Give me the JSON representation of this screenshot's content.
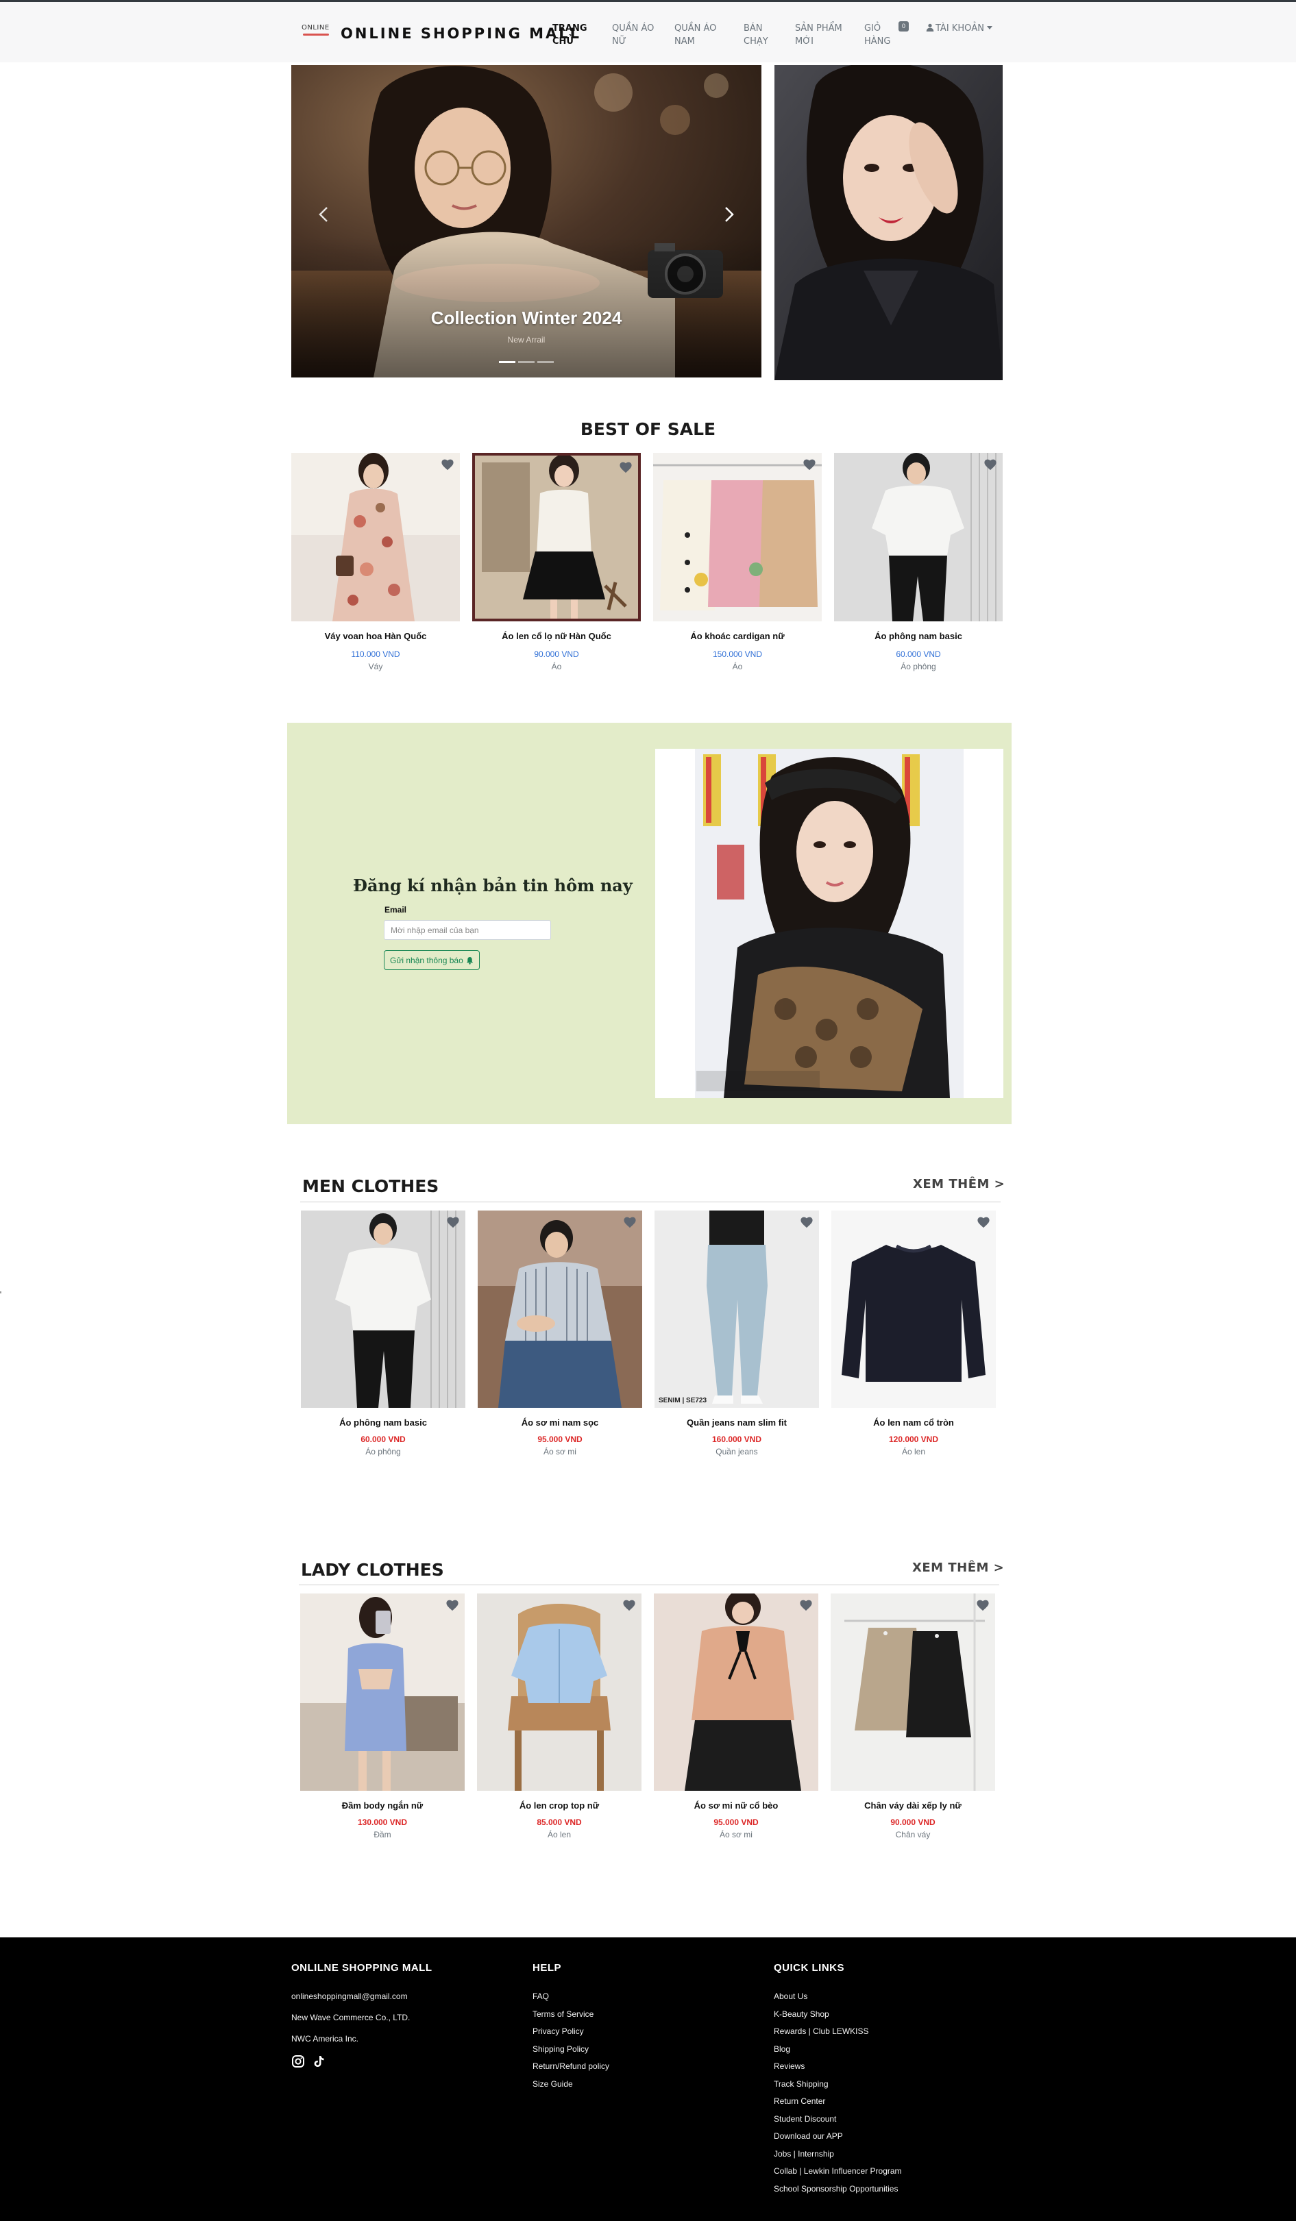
{
  "navbar": {
    "logo_text": "ONLINE",
    "brand": "ONLINE SHOPPING MALL",
    "links": [
      {
        "label": "TRANG CHỦ",
        "active": true
      },
      {
        "label": "QUẦN ÁO NỮ",
        "active": false
      },
      {
        "label": "QUẦN ÁO NAM",
        "active": false
      },
      {
        "label": "BÁN CHẠY",
        "active": false
      },
      {
        "label": "SẢN PHẨM MỚI",
        "active": false
      },
      {
        "label": "GIỎ HÀNG",
        "active": false
      }
    ],
    "cart_count": "0",
    "account_label": "TÀI KHOẢN"
  },
  "hero": {
    "caption_title": "Collection Winter 2024",
    "caption_sub": "New Arrail",
    "slides": 3,
    "active_slide": 0
  },
  "best_of_sale": {
    "title": "BEST OF SALE",
    "items": [
      {
        "name": "Váy voan hoa Hàn Quốc",
        "price": "110.000 VND",
        "category": "Váy"
      },
      {
        "name": "Áo len cổ lọ nữ Hàn Quốc",
        "price": "90.000 VND",
        "category": "Áo"
      },
      {
        "name": "Áo khoác cardigan nữ",
        "price": "150.000 VND",
        "category": "Áo"
      },
      {
        "name": "Áo phông nam basic",
        "price": "60.000 VND",
        "category": "Áo phông"
      }
    ]
  },
  "newsletter": {
    "title": "Đăng kí nhận bản tin hôm nay",
    "email_label": "Email",
    "email_placeholder": "Mời nhập email của bạn",
    "button_label": "Gửi nhận thông báo"
  },
  "men": {
    "title": "MEN CLOTHES",
    "see_more": "XEM THÊM >",
    "items": [
      {
        "name": "Áo phông nam basic",
        "price": "60.000 VND",
        "category": "Áo phông"
      },
      {
        "name": "Áo sơ mi nam sọc",
        "price": "95.000 VND",
        "category": "Áo sơ mi"
      },
      {
        "name": "Quần jeans nam slim fit",
        "price": "160.000 VND",
        "category": "Quần jeans",
        "img_tag": "SENIM | SE723"
      },
      {
        "name": "Áo len nam cổ tròn",
        "price": "120.000 VND",
        "category": "Áo len"
      }
    ]
  },
  "lady": {
    "title": "LADY CLOTHES",
    "see_more": "XEM THÊM >",
    "items": [
      {
        "name": "Đầm body ngắn nữ",
        "price": "130.000 VND",
        "category": "Đầm"
      },
      {
        "name": "Áo len crop top nữ",
        "price": "85.000 VND",
        "category": "Áo len"
      },
      {
        "name": "Áo sơ mi nữ cổ bèo",
        "price": "95.000 VND",
        "category": "Áo sơ mi"
      },
      {
        "name": "Chân váy dài xếp ly nữ",
        "price": "90.000 VND",
        "category": "Chân váy"
      }
    ]
  },
  "footer": {
    "col1": {
      "title": "ONLILNE SHOPPING MALL",
      "lines": [
        "onlineshoppingmall@gmail.com",
        "New Wave Commerce Co., LTD.",
        "NWC America Inc."
      ]
    },
    "help": {
      "title": "HELP",
      "links": [
        "FAQ",
        "Terms of Service",
        "Privacy Policy",
        "Shipping Policy",
        "Return/Refund policy",
        "Size Guide"
      ]
    },
    "quick": {
      "title": "QUICK LINKS",
      "links": [
        "About Us",
        "K-Beauty Shop",
        "Rewards | Club LEWKISS",
        "Blog",
        "Reviews",
        "Track Shipping",
        "Return Center",
        "Student Discount",
        "Download our APP",
        "Jobs | Internship",
        "Collab | Lewkin Influencer Program",
        "School Sponsorship Opportunities"
      ]
    }
  },
  "colors": {
    "accent_blue": "#2f6fd6",
    "price_red": "#dc2626",
    "newsletter_bg": "#e3ecc9",
    "newsletter_btn": "#198754",
    "footer_bg": "#000000"
  }
}
